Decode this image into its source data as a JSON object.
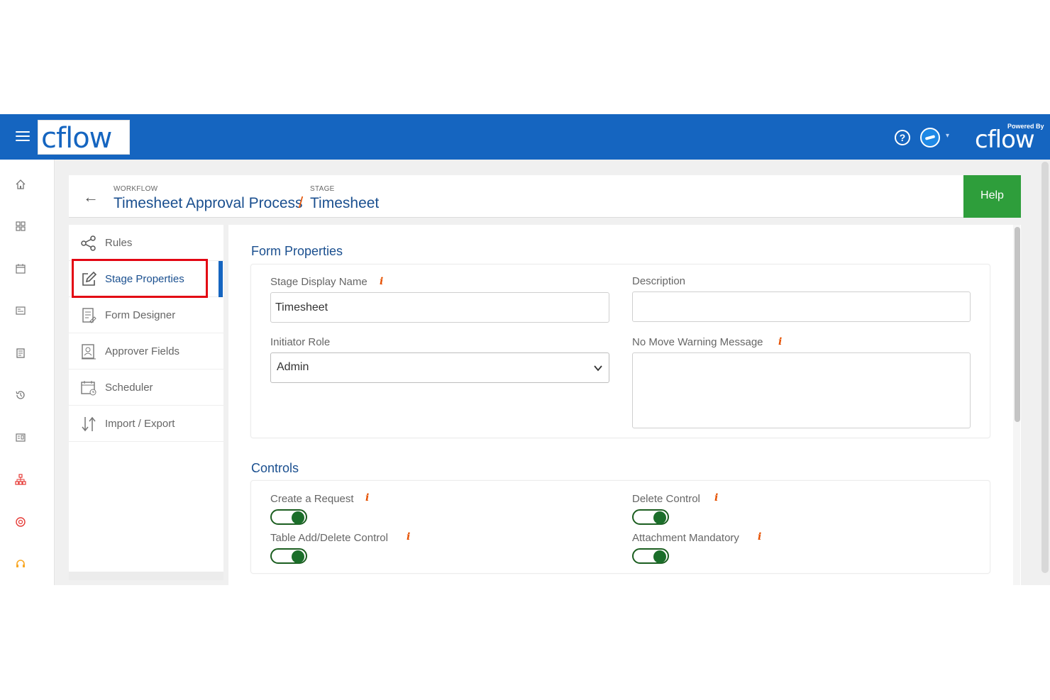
{
  "header": {
    "logo_text": "cflow",
    "powered_by": "Powered By",
    "powered_logo": "cflow",
    "help_icon": "?",
    "avatar_caret": "▾",
    "accent_color": "#1565c0"
  },
  "breadcrumb": {
    "workflow_caption": "WORKFLOW",
    "workflow_name": "Timesheet Approval Process",
    "separator": "/",
    "stage_caption": "STAGE",
    "stage_name": "Timesheet",
    "help_label": "Help"
  },
  "sidemenu": {
    "items": [
      {
        "label": "Rules",
        "icon": "share-nodes-icon"
      },
      {
        "label": "Stage Properties",
        "icon": "edit-icon"
      },
      {
        "label": "Form Designer",
        "icon": "form-designer-icon"
      },
      {
        "label": "Approver Fields",
        "icon": "approver-fields-icon"
      },
      {
        "label": "Scheduler",
        "icon": "calendar-clock-icon"
      },
      {
        "label": "Import / Export",
        "icon": "import-export-icon"
      }
    ],
    "active_index": 1
  },
  "form_properties": {
    "title": "Form Properties",
    "stage_display_name_label": "Stage Display Name",
    "stage_display_name_value": "Timesheet",
    "description_label": "Description",
    "description_value": "",
    "initiator_role_label": "Initiator Role",
    "initiator_role_value": "Admin",
    "no_move_warning_label": "No Move Warning Message",
    "no_move_warning_value": "",
    "info_glyph": "i"
  },
  "controls": {
    "title": "Controls",
    "toggles": [
      {
        "label": "Create a Request",
        "on": true
      },
      {
        "label": "Delete Control",
        "on": true
      },
      {
        "label": "Table Add/Delete Control",
        "on": true
      },
      {
        "label": "Attachment Mandatory",
        "on": true
      }
    ]
  }
}
